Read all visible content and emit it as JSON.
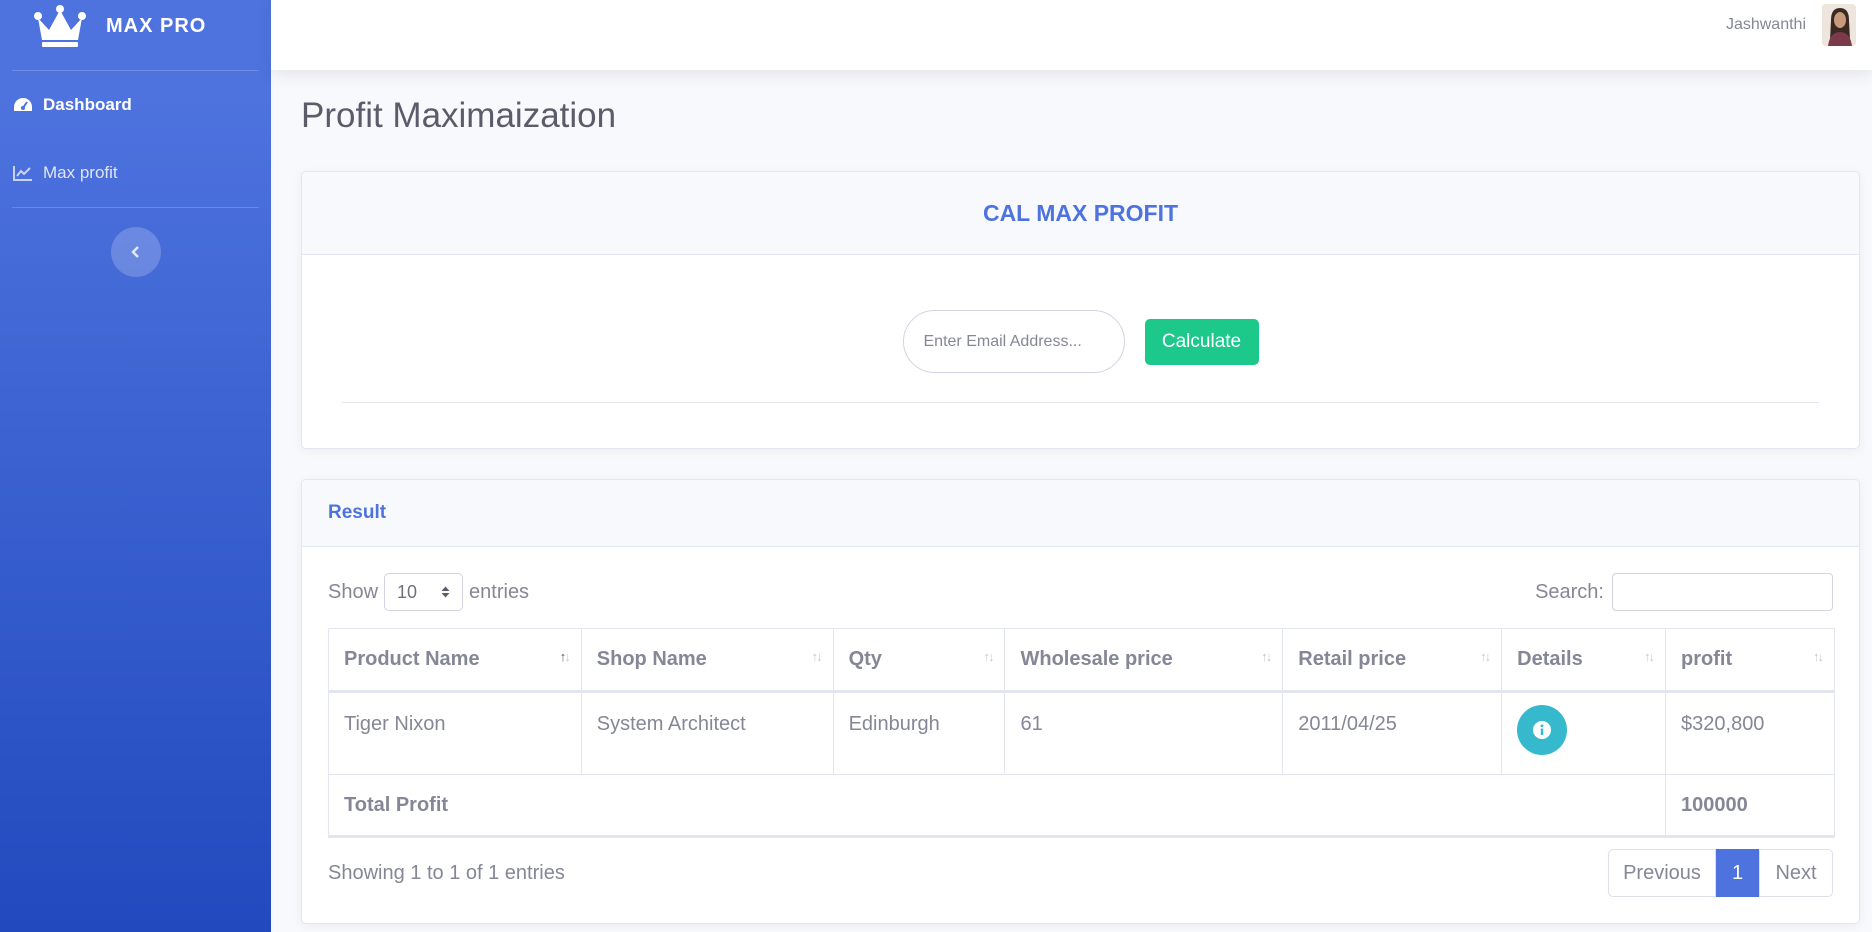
{
  "sidebar": {
    "brand": "MAX PRO",
    "items": [
      {
        "label": "Dashboard",
        "icon": "tachometer-icon"
      },
      {
        "label": "Max profit",
        "icon": "chart-line-icon"
      }
    ]
  },
  "topbar": {
    "user_name": "Jashwanthi"
  },
  "page": {
    "title": "Profit Maximaization"
  },
  "calc_card": {
    "title": "CAL MAX PROFIT",
    "email_placeholder": "Enter Email Address...",
    "button": "Calculate"
  },
  "result_card": {
    "title": "Result",
    "show_label": "Show",
    "entries_label": "entries",
    "page_length": "10",
    "search_label": "Search:",
    "columns": [
      "Product Name",
      "Shop Name",
      "Qty",
      "Wholesale price",
      "Retail price",
      "Details",
      "profit"
    ],
    "rows": [
      {
        "product": "Tiger Nixon",
        "shop": "System Architect",
        "qty": "Edinburgh",
        "wholesale": "61",
        "retail": "2011/04/25",
        "profit": "$320,800"
      }
    ],
    "total_label": "Total Profit",
    "total_value": "100000",
    "info": "Showing 1 to 1 of 1 entries",
    "pager": {
      "previous": "Previous",
      "current": "1",
      "next": "Next"
    }
  },
  "colors": {
    "primary": "#4e73df",
    "success": "#1cc88a",
    "info": "#36b9cc"
  }
}
